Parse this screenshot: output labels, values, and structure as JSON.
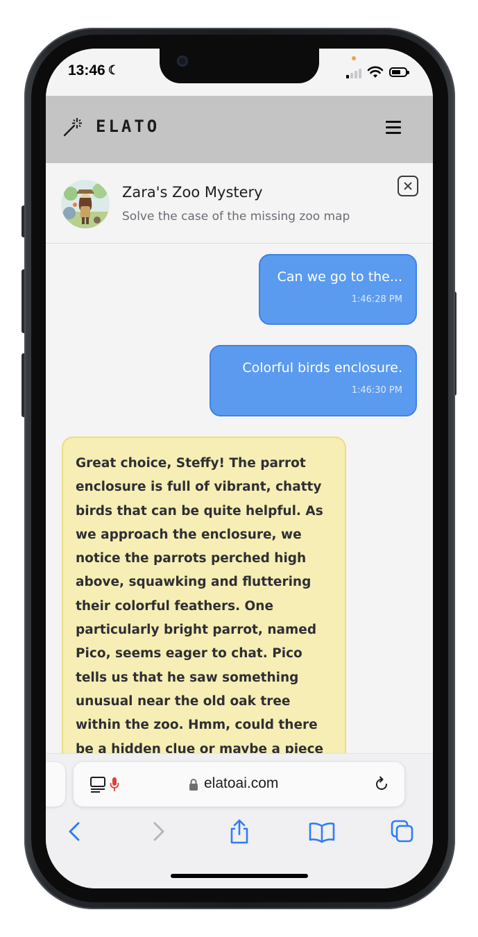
{
  "status_bar": {
    "time": "13:46",
    "focus_icon": "moon-icon",
    "signal_icon": "signal-icon",
    "wifi_icon": "wifi-icon",
    "battery_icon": "battery-icon"
  },
  "app_header": {
    "logo_icon": "magic-wand-icon",
    "brand": "ELATO",
    "menu_icon": "hamburger-menu-icon",
    "background": "#c4c4c4"
  },
  "story": {
    "title": "Zara's Zoo Mystery",
    "subtitle": "Solve the case of the missing zoo map",
    "close_icon": "close-icon"
  },
  "messages": [
    {
      "role": "user",
      "text": "Can we go to the...",
      "time": "1:46:28 PM"
    },
    {
      "role": "user",
      "text": "Colorful birds enclosure.",
      "time": "1:46:30 PM"
    },
    {
      "role": "assistant",
      "text": "Great choice, Steffy! The parrot enclosure is full of vibrant, chatty birds that can be quite helpful. As we approach the enclosure, we notice the parrots perched high above, squawking and fluttering their colorful feathers. One particularly bright parrot, named Pico, seems eager to chat. Pico tells us that he saw something unusual near the old oak tree within the zoo. Hmm, could there be a hidden clue or maybe a piece"
    }
  ],
  "colors": {
    "user_bubble": "#5b9bef",
    "assistant_bubble": "#f6eeb4",
    "assistant_border": "#ecdd7d"
  },
  "browser": {
    "url": "elatoai.com",
    "reader_icon": "reader-mode-icon",
    "mic_icon": "microphone-icon",
    "lock_icon": "lock-icon",
    "reload_icon": "reload-icon",
    "toolbar_icons": [
      "back-icon",
      "forward-icon",
      "share-icon",
      "bookmarks-icon",
      "tabs-icon"
    ]
  }
}
